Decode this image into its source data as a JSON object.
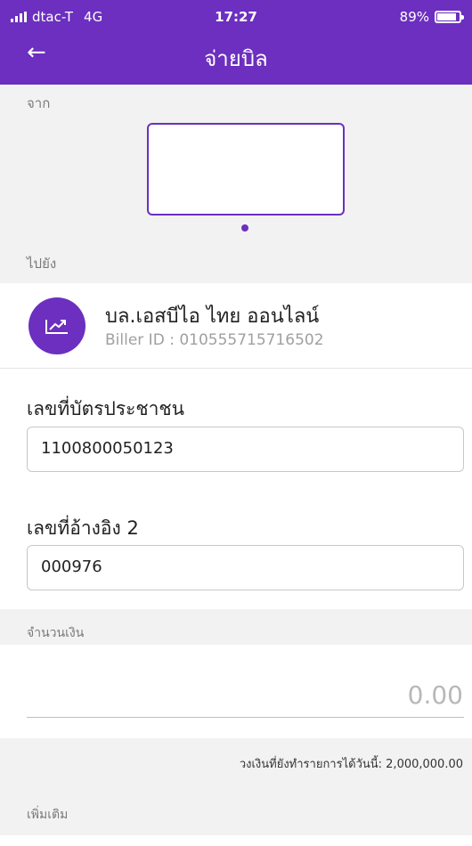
{
  "status": {
    "carrier": "dtac-T",
    "network": "4G",
    "time": "17:27",
    "battery": "89%",
    "battery_level": 0.89
  },
  "navbar": {
    "title": "จ่ายบิล",
    "back_icon": "←"
  },
  "from_label": "จาก",
  "to_label": "ไปยัง",
  "biller": {
    "name": "บล.เอสบีไอ ไทย ออนไลน์",
    "id_text": "Biller ID : 010555715716502",
    "icon": "chart-up-icon"
  },
  "citizen": {
    "label": "เลขที่บัตรประชาชน",
    "value": "1100800050123"
  },
  "ref2": {
    "label": "เลขที่อ้างอิง 2",
    "value": "000976"
  },
  "amount": {
    "label": "จำนวนเงิน",
    "value": "0.00"
  },
  "limit_text": "วงเงินที่ยังทำรายการได้วันนี้: 2,000,000.00",
  "more_label": "เพิ่มเติม"
}
